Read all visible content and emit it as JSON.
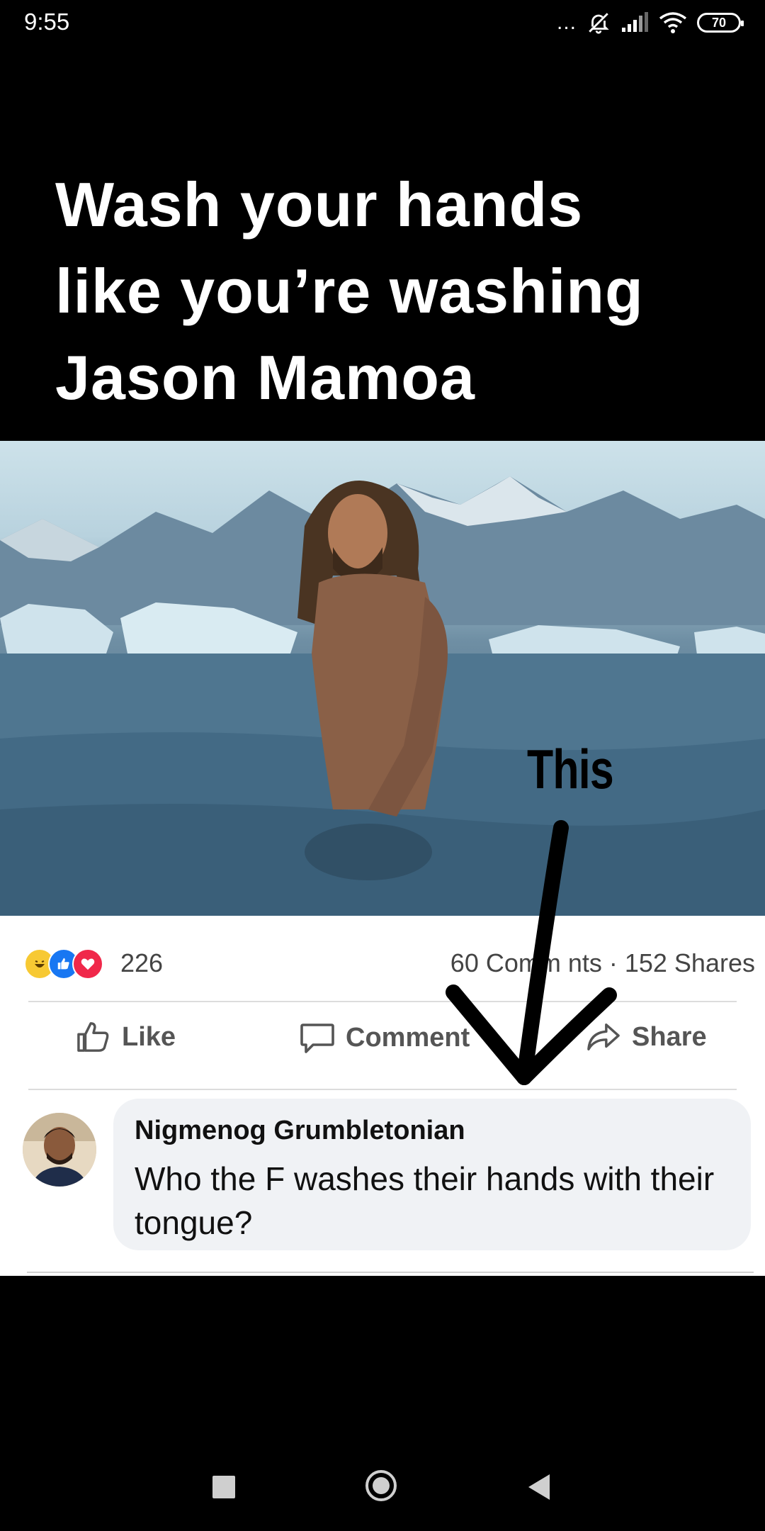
{
  "status_bar": {
    "time": "9:55",
    "dots": "...",
    "battery": "70",
    "icons": [
      "bell-muted-icon",
      "signal-icon",
      "wifi-icon",
      "battery-icon"
    ]
  },
  "meme": {
    "caption_line1": "Wash your hands",
    "caption_line2": "like you’re washing",
    "caption_line3": "Jason Mamoa",
    "overlay_text": "This"
  },
  "post": {
    "reaction_count": "226",
    "comments_shares": "60 Comm  nts · 152 Shares",
    "actions": {
      "like": "Like",
      "comment": "Comment",
      "share": "Share"
    },
    "comment": {
      "author": "Nigmenog Grumbletonian",
      "text": "Who the F washes their hands with their tongue?"
    }
  },
  "colors": {
    "like_blue": "#1877f2",
    "love_red": "#f0284a",
    "haha_yellow": "#f7c933",
    "bubble_bg": "#f0f2f5"
  }
}
